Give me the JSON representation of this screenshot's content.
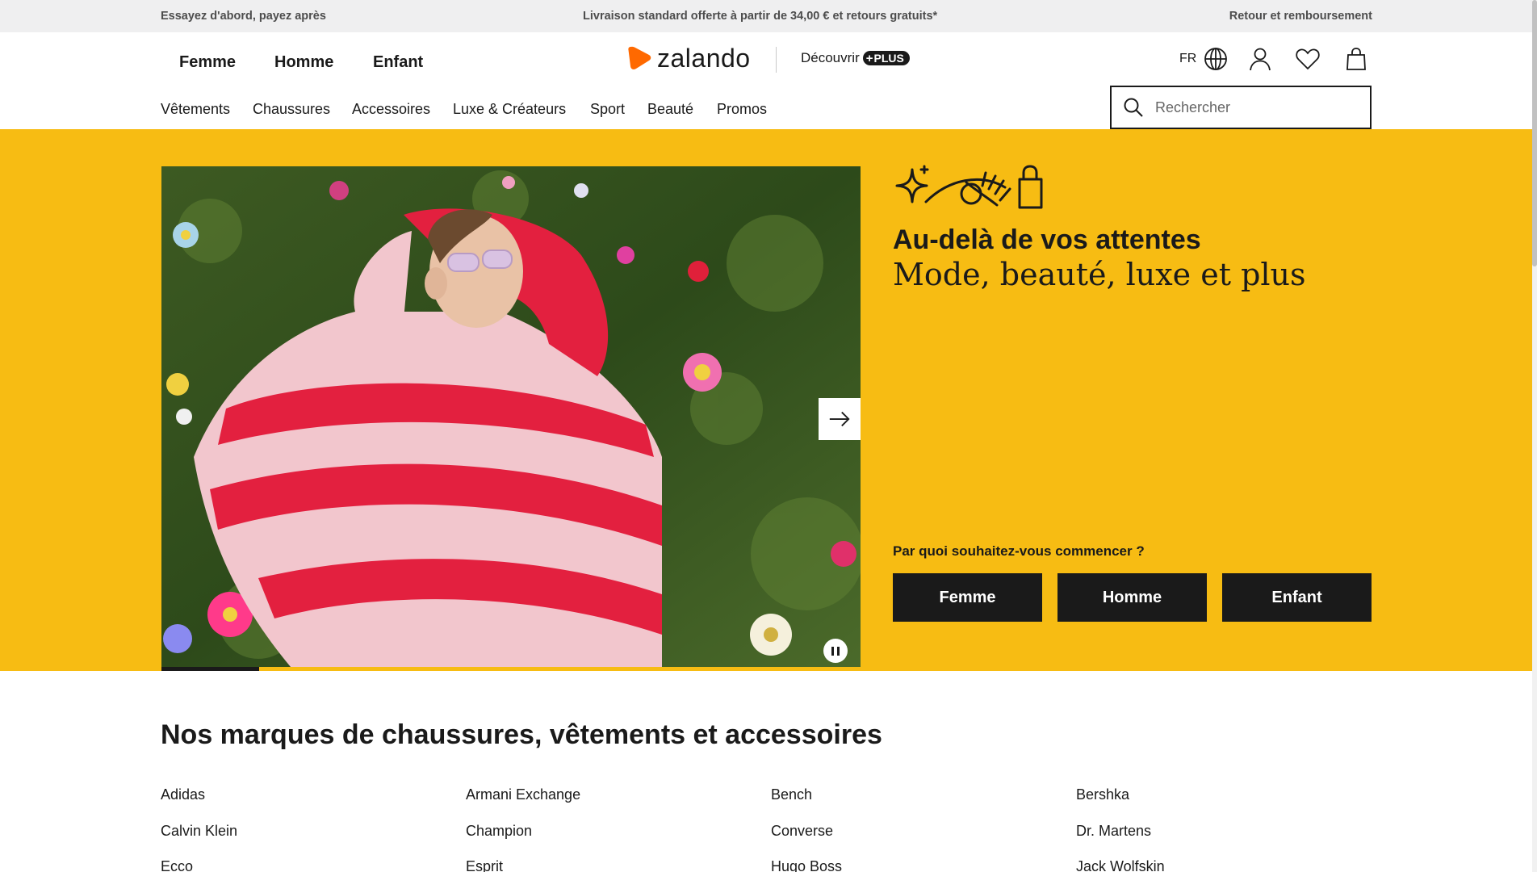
{
  "promo": {
    "left": "Essayez d'abord, payez après",
    "center": "Livraison standard offerte à partir de 34,00 € et retours gratuits*",
    "right": "Retour et remboursement"
  },
  "header": {
    "gender_nav": [
      "Femme",
      "Homme",
      "Enfant"
    ],
    "logo_text": "zalando",
    "discover_label": "Découvrir",
    "plus_label": "PLUS",
    "language": "FR",
    "categories": [
      "Vêtements",
      "Chaussures",
      "Accessoires",
      "Luxe & Créateurs",
      "Sport",
      "Beauté",
      "Promos"
    ],
    "search_placeholder": "Rechercher"
  },
  "hero": {
    "title": "Au-delà de vos attentes",
    "subtitle": "Mode, beauté, luxe et plus",
    "question": "Par quoi souhaitez-vous commencer ?",
    "buttons": [
      "Femme",
      "Homme",
      "Enfant"
    ],
    "carousel_progress": 0.14
  },
  "brands": {
    "title": "Nos marques de chaussures, vêtements et accessoires",
    "items": [
      "Adidas",
      "Armani Exchange",
      "Bench",
      "Bershka",
      "Calvin Klein",
      "Champion",
      "Converse",
      "Dr. Martens",
      "Ecco",
      "Esprit",
      "Hugo Boss",
      "Jack Wolfskin"
    ]
  },
  "colors": {
    "brand_orange": "#ff6900",
    "hero_yellow": "#f7bc13",
    "dark": "#1a1a1a",
    "promo_bg": "#efeff0"
  },
  "icons": [
    "globe-icon",
    "user-icon",
    "heart-icon",
    "bag-icon",
    "search-icon",
    "arrow-right-icon",
    "pause-icon",
    "sparkle-icon",
    "eye-icon",
    "shopping-bag-icon"
  ]
}
